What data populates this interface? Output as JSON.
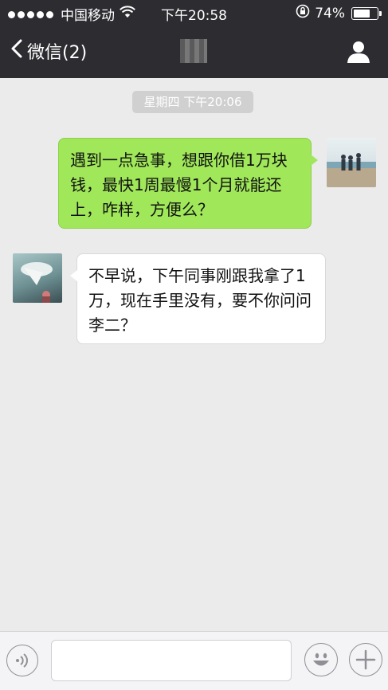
{
  "status_bar": {
    "carrier": "中国移动",
    "time": "下午20:58",
    "battery_percent": "74%",
    "battery_level": 0.74,
    "icons": [
      "signal-dots",
      "wifi-icon",
      "rotation-lock-icon",
      "battery-icon"
    ]
  },
  "nav": {
    "back_label": "微信(2)",
    "icons": [
      "chevron-left-icon",
      "person-icon"
    ]
  },
  "chat": {
    "timestamp": "星期四 下午20:06",
    "messages": [
      {
        "direction": "outgoing",
        "text": "遇到一点急事，想跟你借1万块钱，最快1周最慢1个月就能还上，咋样，方便么？"
      },
      {
        "direction": "incoming",
        "text": "不早说，下午同事刚跟我拿了1万，现在手里没有，要不你问问李二？"
      }
    ]
  },
  "input_bar": {
    "value": "",
    "icons": [
      "voice-icon",
      "emoji-icon",
      "plus-icon"
    ]
  },
  "colors": {
    "header_bg": "#2d2c31",
    "chat_bg": "#ebebeb",
    "outgoing_bubble": "#a0e75a",
    "incoming_bubble": "#ffffff"
  }
}
